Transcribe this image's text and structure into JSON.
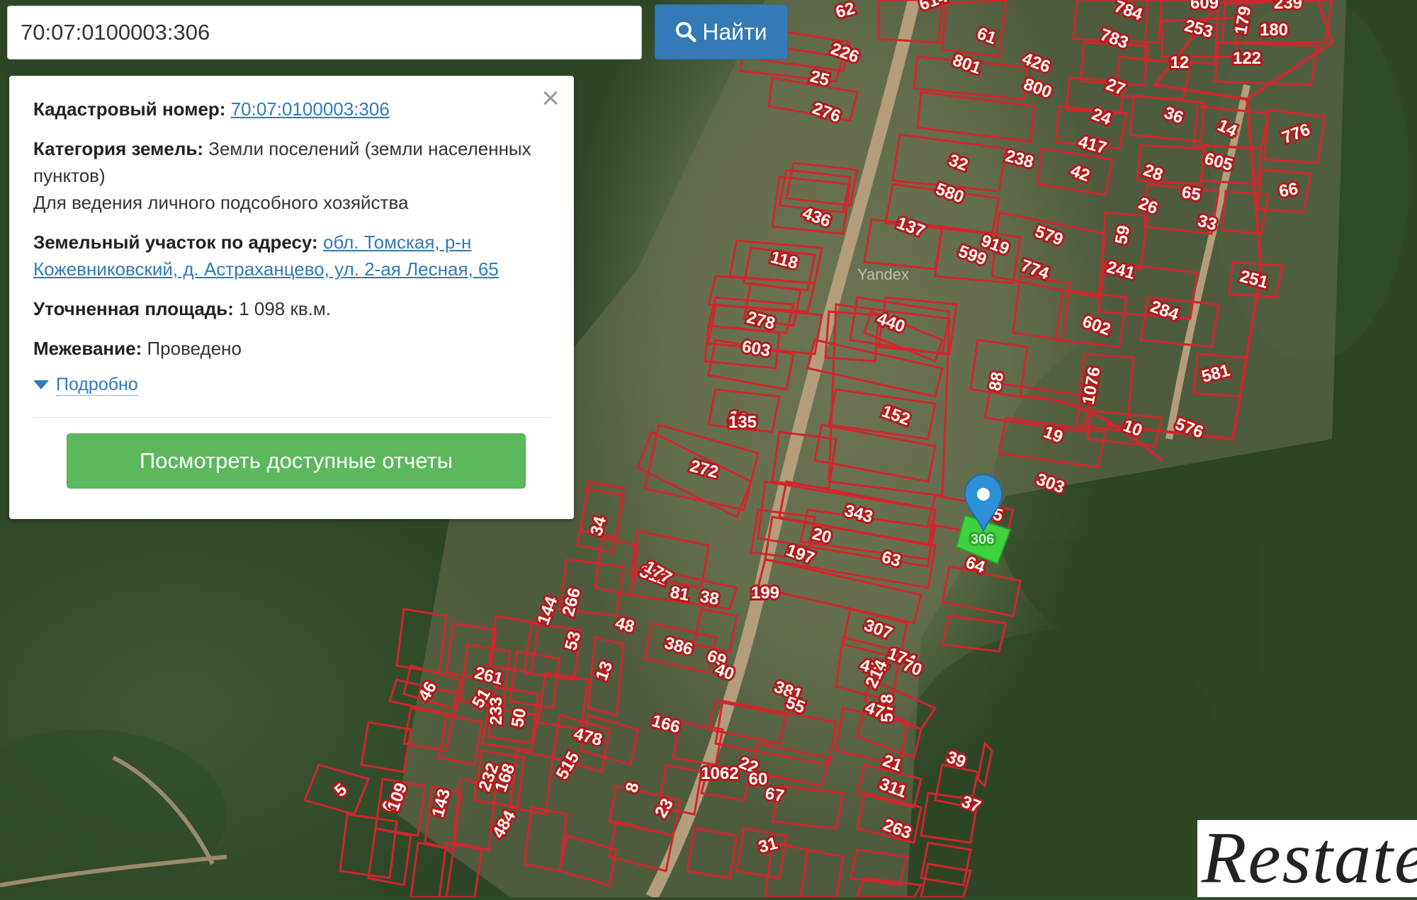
{
  "search": {
    "value": "70:07:0100003:306",
    "button_label": "Найти"
  },
  "info": {
    "cadastral_label": "Кадастровый номер:",
    "cadastral_value": "70:07:0100003:306",
    "category_label": "Категория земель:",
    "category_value": "Земли поселений (земли населенных пунктов)",
    "usage": "Для ведения личного подсобного хозяйства",
    "address_label": "Земельный участок по адресу:",
    "address_value": "обл. Томская, р-н Кожевниковский, д. Астраханцево, ул. 2-ая Лесная, 65",
    "area_label": "Уточненная площадь:",
    "area_value": "1 098 кв.м.",
    "survey_label": "Межевание:",
    "survey_value": "Проведено",
    "more_label": "Подробно",
    "reports_button": "Посмотреть доступные отчеты"
  },
  "map": {
    "selected_parcel": "306",
    "provider_watermark": "Yandex",
    "parcel_labels": [
      "62",
      "614",
      "784",
      "609",
      "179",
      "239",
      "226",
      "61",
      "783",
      "253",
      "180",
      "25",
      "801",
      "426",
      "12",
      "122",
      "276",
      "800",
      "27",
      "36",
      "14",
      "776",
      "24",
      "417",
      "605",
      "32",
      "238",
      "28",
      "580",
      "42",
      "65",
      "66",
      "436",
      "26",
      "137",
      "579",
      "33",
      "59",
      "919",
      "251",
      "118",
      "599",
      "774",
      "241",
      "440",
      "284",
      "278",
      "602",
      "581",
      "603",
      "88",
      "1076",
      "102",
      "152",
      "19",
      "10",
      "576",
      "135",
      "272",
      "303",
      "34",
      "343",
      "20",
      "35",
      "197",
      "64",
      "63",
      "312",
      "177",
      "307",
      "81",
      "174",
      "69",
      "144",
      "427",
      "38",
      "199",
      "266",
      "48",
      "386",
      "13",
      "70",
      "40",
      "261",
      "53",
      "381",
      "214",
      "55",
      "578",
      "46",
      "51",
      "233",
      "50",
      "478",
      "166",
      "47",
      "515",
      "232",
      "168",
      "21",
      "8",
      "22",
      "39",
      "1062",
      "60",
      "23",
      "484",
      "311",
      "5",
      "6",
      "109",
      "143",
      "67",
      "37",
      "263",
      "31"
    ],
    "colors": {
      "parcel_outline": "#d0262b",
      "selected_fill": "#3fd23f",
      "marker": "#2f8fd8"
    }
  },
  "watermark": "Restate"
}
